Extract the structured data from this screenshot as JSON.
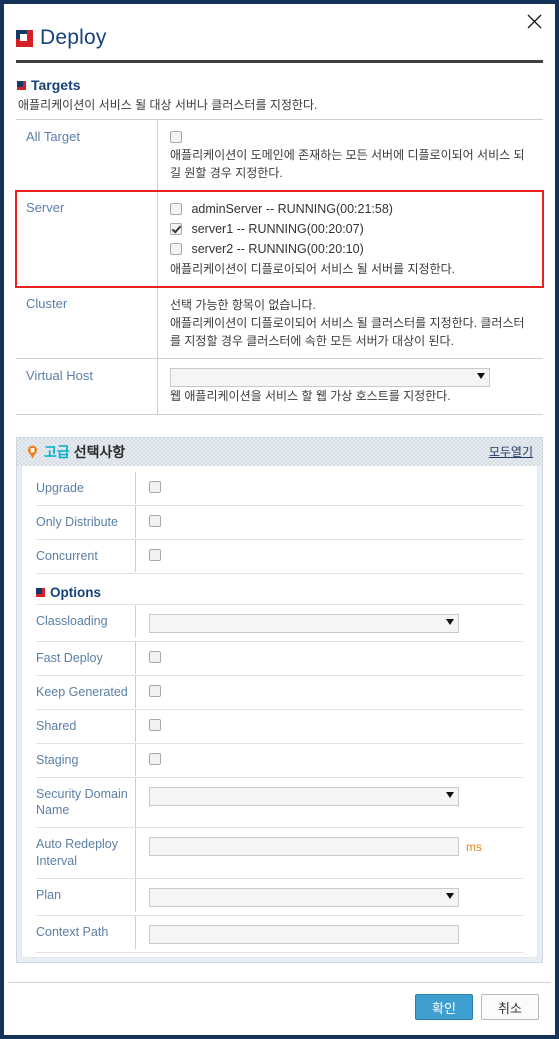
{
  "window": {
    "title": "Deploy",
    "close_label": "×",
    "brand_icon": "deploy-logo-icon",
    "border_color": "#153359"
  },
  "targets": {
    "heading": "Targets",
    "description": "애플리케이션이 서비스 될 대상 서버나 클러스터를 지정한다.",
    "rows": [
      {
        "label": "All Target",
        "hint": "애플리케이션이 도메인에 존재하는 모든 서버에 디플로이되어 서비스 되길 원할 경우 지정한다."
      },
      {
        "label": "Server",
        "servers": [
          {
            "name": "adminServer -- RUNNING(00:21:58)",
            "checked": false
          },
          {
            "name": "server1 -- RUNNING(00:20:07)",
            "checked": true
          },
          {
            "name": "server2 -- RUNNING(00:20:10)",
            "checked": false
          }
        ],
        "hint": "애플리케이션이 디플로이되어 서비스 될 서버를 지정한다.",
        "highlight_color": "#e8231f"
      },
      {
        "label": "Cluster",
        "empty_text": "선택 가능한 항목이 없습니다.",
        "hint": "애플리케이션이 디플로이되어 서비스 될 클러스터를 지정한다. 클러스터를 지정할 경우 클러스터에 속한 모든 서버가 대상이 된다."
      },
      {
        "label": "Virtual Host",
        "select_value": "",
        "hint": "웹 애플리케이션을 서비스 할 웹 가상 호스트를 지정한다."
      }
    ]
  },
  "advanced": {
    "badge_text": "고급",
    "title_text": "선택사항",
    "badge_color": "#00b0c8",
    "expand_all_label": "모두열기",
    "bulb_icon": "lightbulb-icon",
    "toggles": [
      {
        "label": "Upgrade",
        "checked": false
      },
      {
        "label": "Only Distribute",
        "checked": false
      },
      {
        "label": "Concurrent",
        "checked": false
      }
    ],
    "options_heading": "Options",
    "option_fields": [
      {
        "label": "Classloading",
        "type": "select",
        "value": ""
      },
      {
        "label": "Fast Deploy",
        "type": "checkbox",
        "checked": false
      },
      {
        "label": "Keep Generated",
        "type": "checkbox",
        "checked": false
      },
      {
        "label": "Shared",
        "type": "checkbox",
        "checked": false
      },
      {
        "label": "Staging",
        "type": "checkbox",
        "checked": false
      },
      {
        "label": "Security Domain Name",
        "type": "select",
        "value": ""
      },
      {
        "label": "Auto Redeploy Interval",
        "type": "text",
        "value": "",
        "unit": "ms"
      },
      {
        "label": "Plan",
        "type": "select",
        "value": ""
      },
      {
        "label": "Context Path",
        "type": "text",
        "value": ""
      }
    ]
  },
  "footer": {
    "ok_label": "확인",
    "cancel_label": "취소",
    "ok_color": "#3e9fd0"
  }
}
